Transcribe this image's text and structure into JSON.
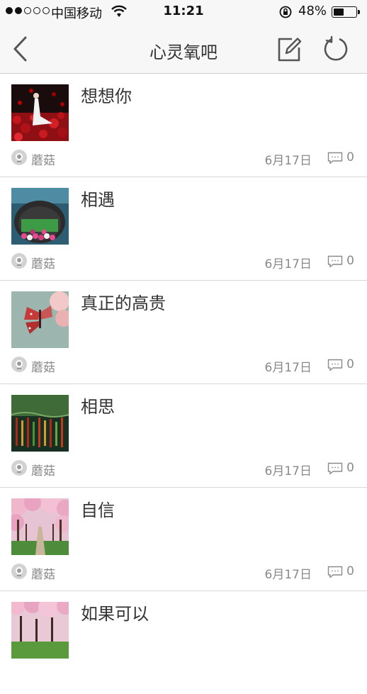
{
  "status_bar": {
    "carrier": "中国移动",
    "time": "11:21",
    "battery_percent": "48%",
    "battery_level": 0.48,
    "signal_bars_filled": 2,
    "signal_bars_total": 5
  },
  "nav": {
    "title": "心灵氧吧",
    "back_icon": "chevron-left-icon",
    "compose_icon": "compose-icon",
    "refresh_icon": "refresh-icon"
  },
  "colors": {
    "header_bg": "#f7f7f7",
    "text_primary": "#333333",
    "text_secondary": "#8a8a8a",
    "divider": "#d8d8d8"
  },
  "posts": [
    {
      "title": "想想你",
      "author": "蘑菇",
      "date": "6月17日",
      "comments": "0",
      "thumbnail": "woman-in-red-roses"
    },
    {
      "title": "相遇",
      "author": "蘑菇",
      "date": "6月17日",
      "comments": "0",
      "thumbnail": "boat-with-flowers"
    },
    {
      "title": "真正的高贵",
      "author": "蘑菇",
      "date": "6月17日",
      "comments": "0",
      "thumbnail": "butterfly"
    },
    {
      "title": "相思",
      "author": "蘑菇",
      "date": "6月17日",
      "comments": "0",
      "thumbnail": "reflections-in-water"
    },
    {
      "title": "自信",
      "author": "蘑菇",
      "date": "6月17日",
      "comments": "0",
      "thumbnail": "cherry-blossom-path"
    },
    {
      "title": "如果可以",
      "author": "",
      "date": "",
      "comments": "",
      "thumbnail": "cherry-blossom-park"
    }
  ]
}
